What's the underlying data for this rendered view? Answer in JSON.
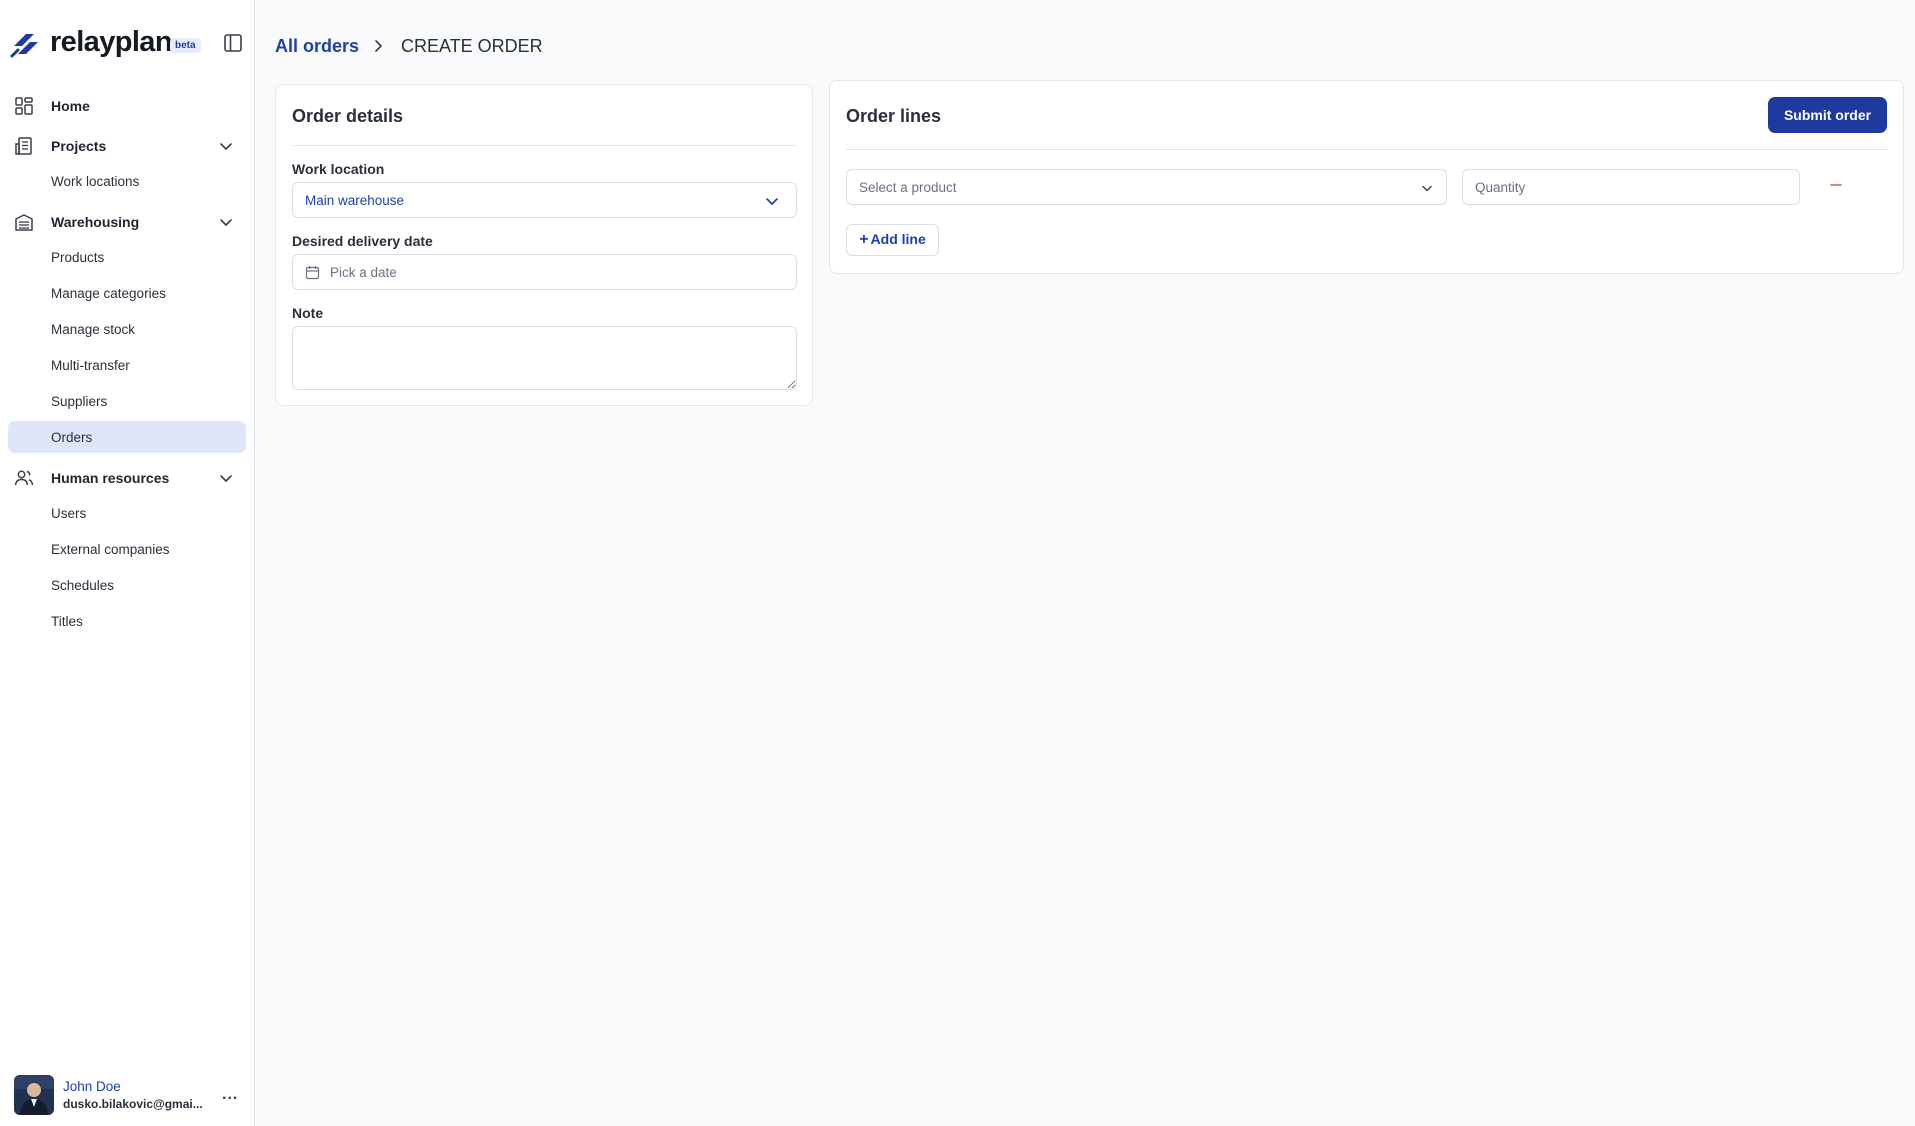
{
  "app": {
    "name": "relayplan",
    "badge": "beta"
  },
  "sidebar": {
    "groups": [
      {
        "label": "Home",
        "icon": "grid-icon"
      },
      {
        "label": "Projects",
        "icon": "building-icon",
        "items": [
          "Work locations"
        ]
      },
      {
        "label": "Warehousing",
        "icon": "warehouse-icon",
        "items": [
          "Products",
          "Manage categories",
          "Manage stock",
          "Multi-transfer",
          "Suppliers",
          "Orders"
        ]
      },
      {
        "label": "Human resources",
        "icon": "users-icon",
        "items": [
          "Users",
          "External companies",
          "Schedules",
          "Titles"
        ]
      }
    ],
    "home": "Home",
    "projects": "Projects",
    "work_locations": "Work locations",
    "warehousing": "Warehousing",
    "products": "Products",
    "manage_categories": "Manage categories",
    "manage_stock": "Manage stock",
    "multi_transfer": "Multi-transfer",
    "suppliers": "Suppliers",
    "orders": "Orders",
    "human_resources": "Human resources",
    "users": "Users",
    "external_companies": "External companies",
    "schedules": "Schedules",
    "titles": "Titles",
    "active_item": "Orders"
  },
  "user": {
    "name": "John Doe",
    "email": "dusko.bilakovic@gmai...",
    "more": "..."
  },
  "breadcrumb": {
    "parent": "All orders",
    "current": "CREATE ORDER"
  },
  "order_details": {
    "title": "Order details",
    "work_location_label": "Work location",
    "work_location_value": "Main warehouse",
    "delivery_label": "Desired delivery date",
    "delivery_placeholder": "Pick a date",
    "note_label": "Note",
    "note_value": ""
  },
  "order_lines": {
    "title": "Order lines",
    "submit_label": "Submit order",
    "product_placeholder": "Select a product",
    "quantity_placeholder": "Quantity",
    "add_line_label": "Add line"
  },
  "colors": {
    "accent": "#1e3fa8",
    "primary_button": "#1e3a9e",
    "active_nav": "#dfe6f7",
    "remove": "#e05252"
  }
}
